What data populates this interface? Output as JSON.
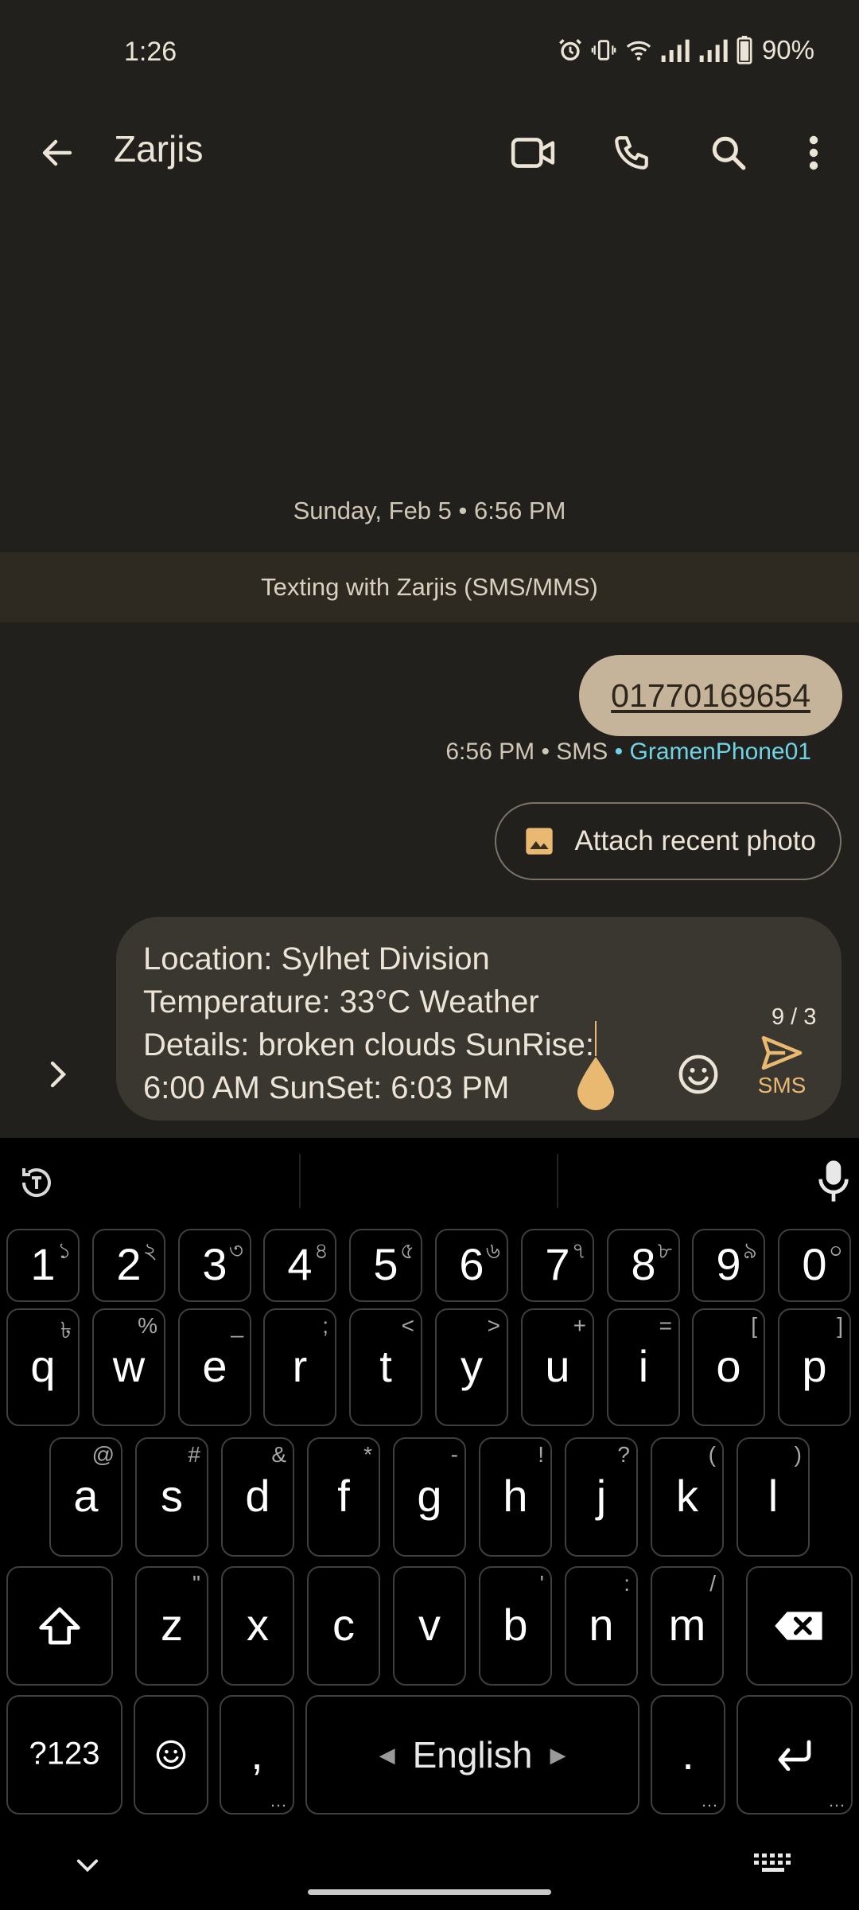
{
  "status_bar": {
    "time": "1:26",
    "battery": "90%",
    "icons": [
      "alarm-icon",
      "vibrate-icon",
      "wifi-icon",
      "signal-icon",
      "signal-icon",
      "battery-icon"
    ]
  },
  "app_bar": {
    "title": "Zarjis",
    "actions": [
      "video-call-icon",
      "phone-icon",
      "search-icon",
      "more-vert-icon"
    ]
  },
  "conversation": {
    "date": "Sunday, Feb 5 • 6:56 PM",
    "banner": "Texting with Zarjis (SMS/MMS)",
    "messages": [
      {
        "text": "01770169654",
        "time": "6:56 PM",
        "type": "SMS",
        "sim": "GramenPhone01"
      }
    ],
    "suggestion_chip": "Attach recent photo"
  },
  "compose": {
    "text": "Location: Sylhet Division\nTemperature: 33°C Weather\nDetails: broken clouds SunRise:\n6:00 AM SunSet: 6:03 PM",
    "counter": "9 / 3",
    "send_label": "SMS"
  },
  "keyboard": {
    "number_row": [
      {
        "k": "1",
        "h": "১"
      },
      {
        "k": "2",
        "h": "২"
      },
      {
        "k": "3",
        "h": "৩"
      },
      {
        "k": "4",
        "h": "৪"
      },
      {
        "k": "5",
        "h": "৫"
      },
      {
        "k": "6",
        "h": "৬"
      },
      {
        "k": "7",
        "h": "৭"
      },
      {
        "k": "8",
        "h": "৮"
      },
      {
        "k": "9",
        "h": "৯"
      },
      {
        "k": "0",
        "h": "০"
      }
    ],
    "row1": [
      {
        "k": "q",
        "h": "৳"
      },
      {
        "k": "w",
        "h": "%"
      },
      {
        "k": "e",
        "h": "_"
      },
      {
        "k": "r",
        "h": ";"
      },
      {
        "k": "t",
        "h": "<"
      },
      {
        "k": "y",
        "h": ">"
      },
      {
        "k": "u",
        "h": "+"
      },
      {
        "k": "i",
        "h": "="
      },
      {
        "k": "o",
        "h": "["
      },
      {
        "k": "p",
        "h": "]"
      }
    ],
    "row2": [
      {
        "k": "a",
        "h": "@"
      },
      {
        "k": "s",
        "h": "#"
      },
      {
        "k": "d",
        "h": "&"
      },
      {
        "k": "f",
        "h": "*"
      },
      {
        "k": "g",
        "h": "-"
      },
      {
        "k": "h",
        "h": "!"
      },
      {
        "k": "j",
        "h": "?"
      },
      {
        "k": "k",
        "h": "("
      },
      {
        "k": "l",
        "h": ")"
      }
    ],
    "row3": [
      {
        "k": "z",
        "h": "\""
      },
      {
        "k": "x",
        "h": ""
      },
      {
        "k": "c",
        "h": ""
      },
      {
        "k": "v",
        "h": ""
      },
      {
        "k": "b",
        "h": "'"
      },
      {
        "k": "n",
        "h": ":"
      },
      {
        "k": "m",
        "h": "/"
      }
    ],
    "symbols_label": "?123",
    "comma": ",",
    "space_label": "English",
    "period": "."
  }
}
